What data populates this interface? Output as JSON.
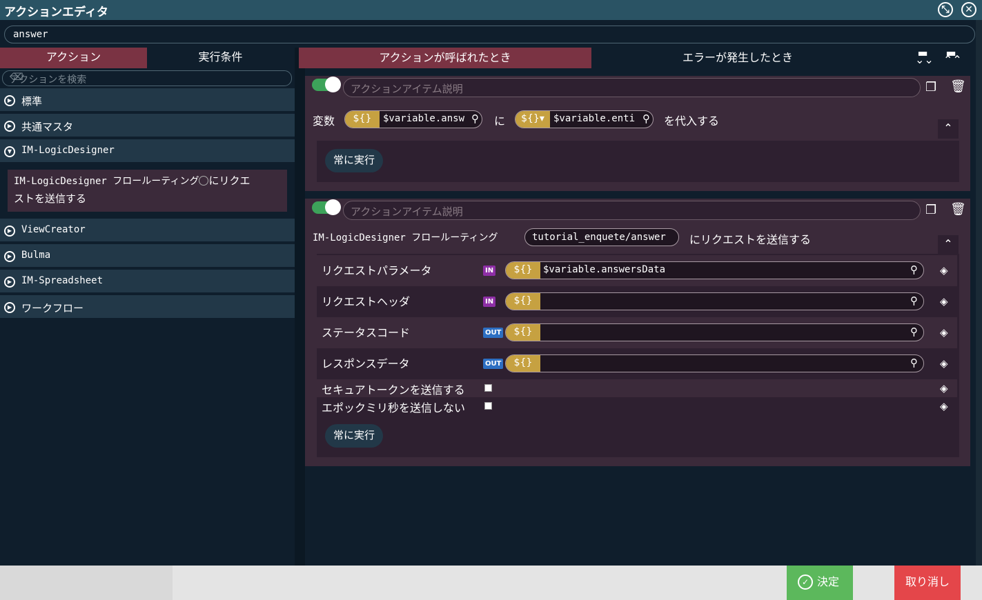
{
  "window": {
    "title": "アクションエディタ",
    "restore_icon": "compress-icon",
    "close_icon": "close-icon"
  },
  "search": {
    "value": "answer"
  },
  "left_tabs": [
    {
      "label": "アクション",
      "active": true
    },
    {
      "label": "実行条件",
      "active": false
    }
  ],
  "filter": {
    "placeholder": "アクションを検索"
  },
  "categories": [
    {
      "label": "標準",
      "expanded": false
    },
    {
      "label": "共通マスタ",
      "expanded": false
    },
    {
      "label": "IM-LogicDesigner",
      "expanded": true
    },
    {
      "label": "ViewCreator",
      "expanded": false
    },
    {
      "label": "Bulma",
      "expanded": false
    },
    {
      "label": "IM-Spreadsheet",
      "expanded": false
    },
    {
      "label": "ワークフロー",
      "expanded": false
    }
  ],
  "sub_item": {
    "line1": "IM-LogicDesigner フロールーティング",
    "line1b": "にリクエ",
    "line2": "ストを送信する"
  },
  "right_tabs": [
    {
      "label": "アクションが呼ばれたとき",
      "active": true
    },
    {
      "label": "エラーが発生したとき",
      "active": false
    }
  ],
  "dollar": "${}",
  "cards": [
    {
      "desc_placeholder": "アクションアイテム説明",
      "var_label": "変数",
      "var_value": "$variable.answ",
      "ni": "に",
      "src_value": "$variable.enti",
      "assign": "を代入する",
      "run": "常に実行"
    },
    {
      "desc_placeholder": "アクションアイテム説明",
      "prefix": "IM-LogicDesigner フロールーティング",
      "route": "tutorial_enquete/answer",
      "suffix": "にリクエストを送信する",
      "params": [
        {
          "label": "リクエストパラメータ",
          "dir": "IN",
          "value": "$variable.answersData"
        },
        {
          "label": "リクエストヘッダ",
          "dir": "IN",
          "value": ""
        },
        {
          "label": "ステータスコード",
          "dir": "OUT",
          "value": ""
        },
        {
          "label": "レスポンスデータ",
          "dir": "OUT",
          "value": ""
        }
      ],
      "checks": [
        {
          "label": "セキュアトークンを送信する",
          "checked": false
        },
        {
          "label": "エポックミリ秒を送信しない",
          "checked": false
        }
      ],
      "run": "常に実行"
    }
  ],
  "footer": {
    "ok": "決定",
    "cancel": "取り消し"
  },
  "colors": {
    "accent": "#7a3343",
    "ok": "#5cb85c",
    "cancel": "#e4464a",
    "dollar": "#c6a141",
    "in_badge": "#8e2fa6",
    "out_badge": "#2d6fc2"
  }
}
